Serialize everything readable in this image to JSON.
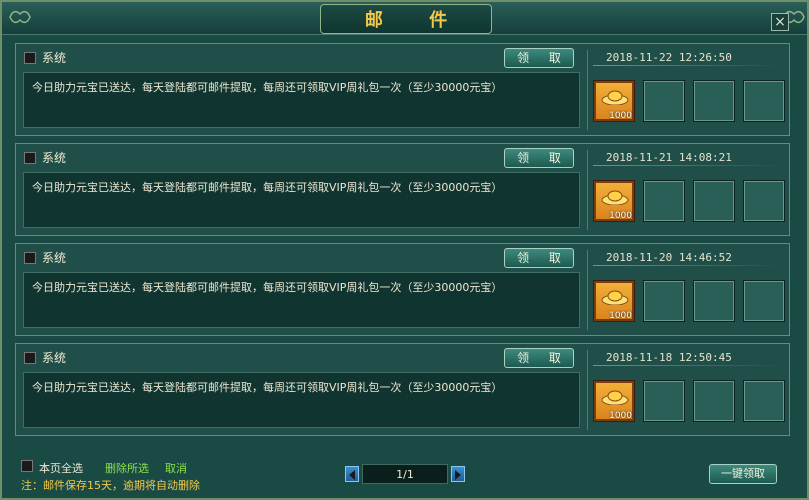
{
  "window": {
    "title": "邮 件",
    "close_label": "×"
  },
  "mails": [
    {
      "sender": "系统",
      "claim_label": "领 取",
      "date": "2018-11-22 12:26:50",
      "body": "今日助力元宝已送达，每天登陆都可邮件提取，每周还可领取VIP周礼包一次（至少30000元宝）",
      "item_qty": "1000"
    },
    {
      "sender": "系统",
      "claim_label": "领 取",
      "date": "2018-11-21 14:08:21",
      "body": "今日助力元宝已送达，每天登陆都可邮件提取，每周还可领取VIP周礼包一次（至少30000元宝）",
      "item_qty": "1000"
    },
    {
      "sender": "系统",
      "claim_label": "领 取",
      "date": "2018-11-20 14:46:52",
      "body": "今日助力元宝已送达，每天登陆都可邮件提取，每周还可领取VIP周礼包一次（至少30000元宝）",
      "item_qty": "1000"
    },
    {
      "sender": "系统",
      "claim_label": "领 取",
      "date": "2018-11-18 12:50:45",
      "body": "今日助力元宝已送达，每天登陆都可邮件提取，每周还可领取VIP周礼包一次（至少30000元宝）",
      "item_qty": "1000"
    }
  ],
  "footer": {
    "select_all_label": "本页全选",
    "delete_selected_label": "删除所选",
    "cancel_label": "取消",
    "note": "注：邮件保存15天，逾期将自动删除",
    "page_indicator": "1/1",
    "claim_all_label": "一键领取"
  },
  "colors": {
    "accent_gold": "#f2c94a",
    "link_green": "#8be04a",
    "item_orange": "#e89a2a"
  }
}
